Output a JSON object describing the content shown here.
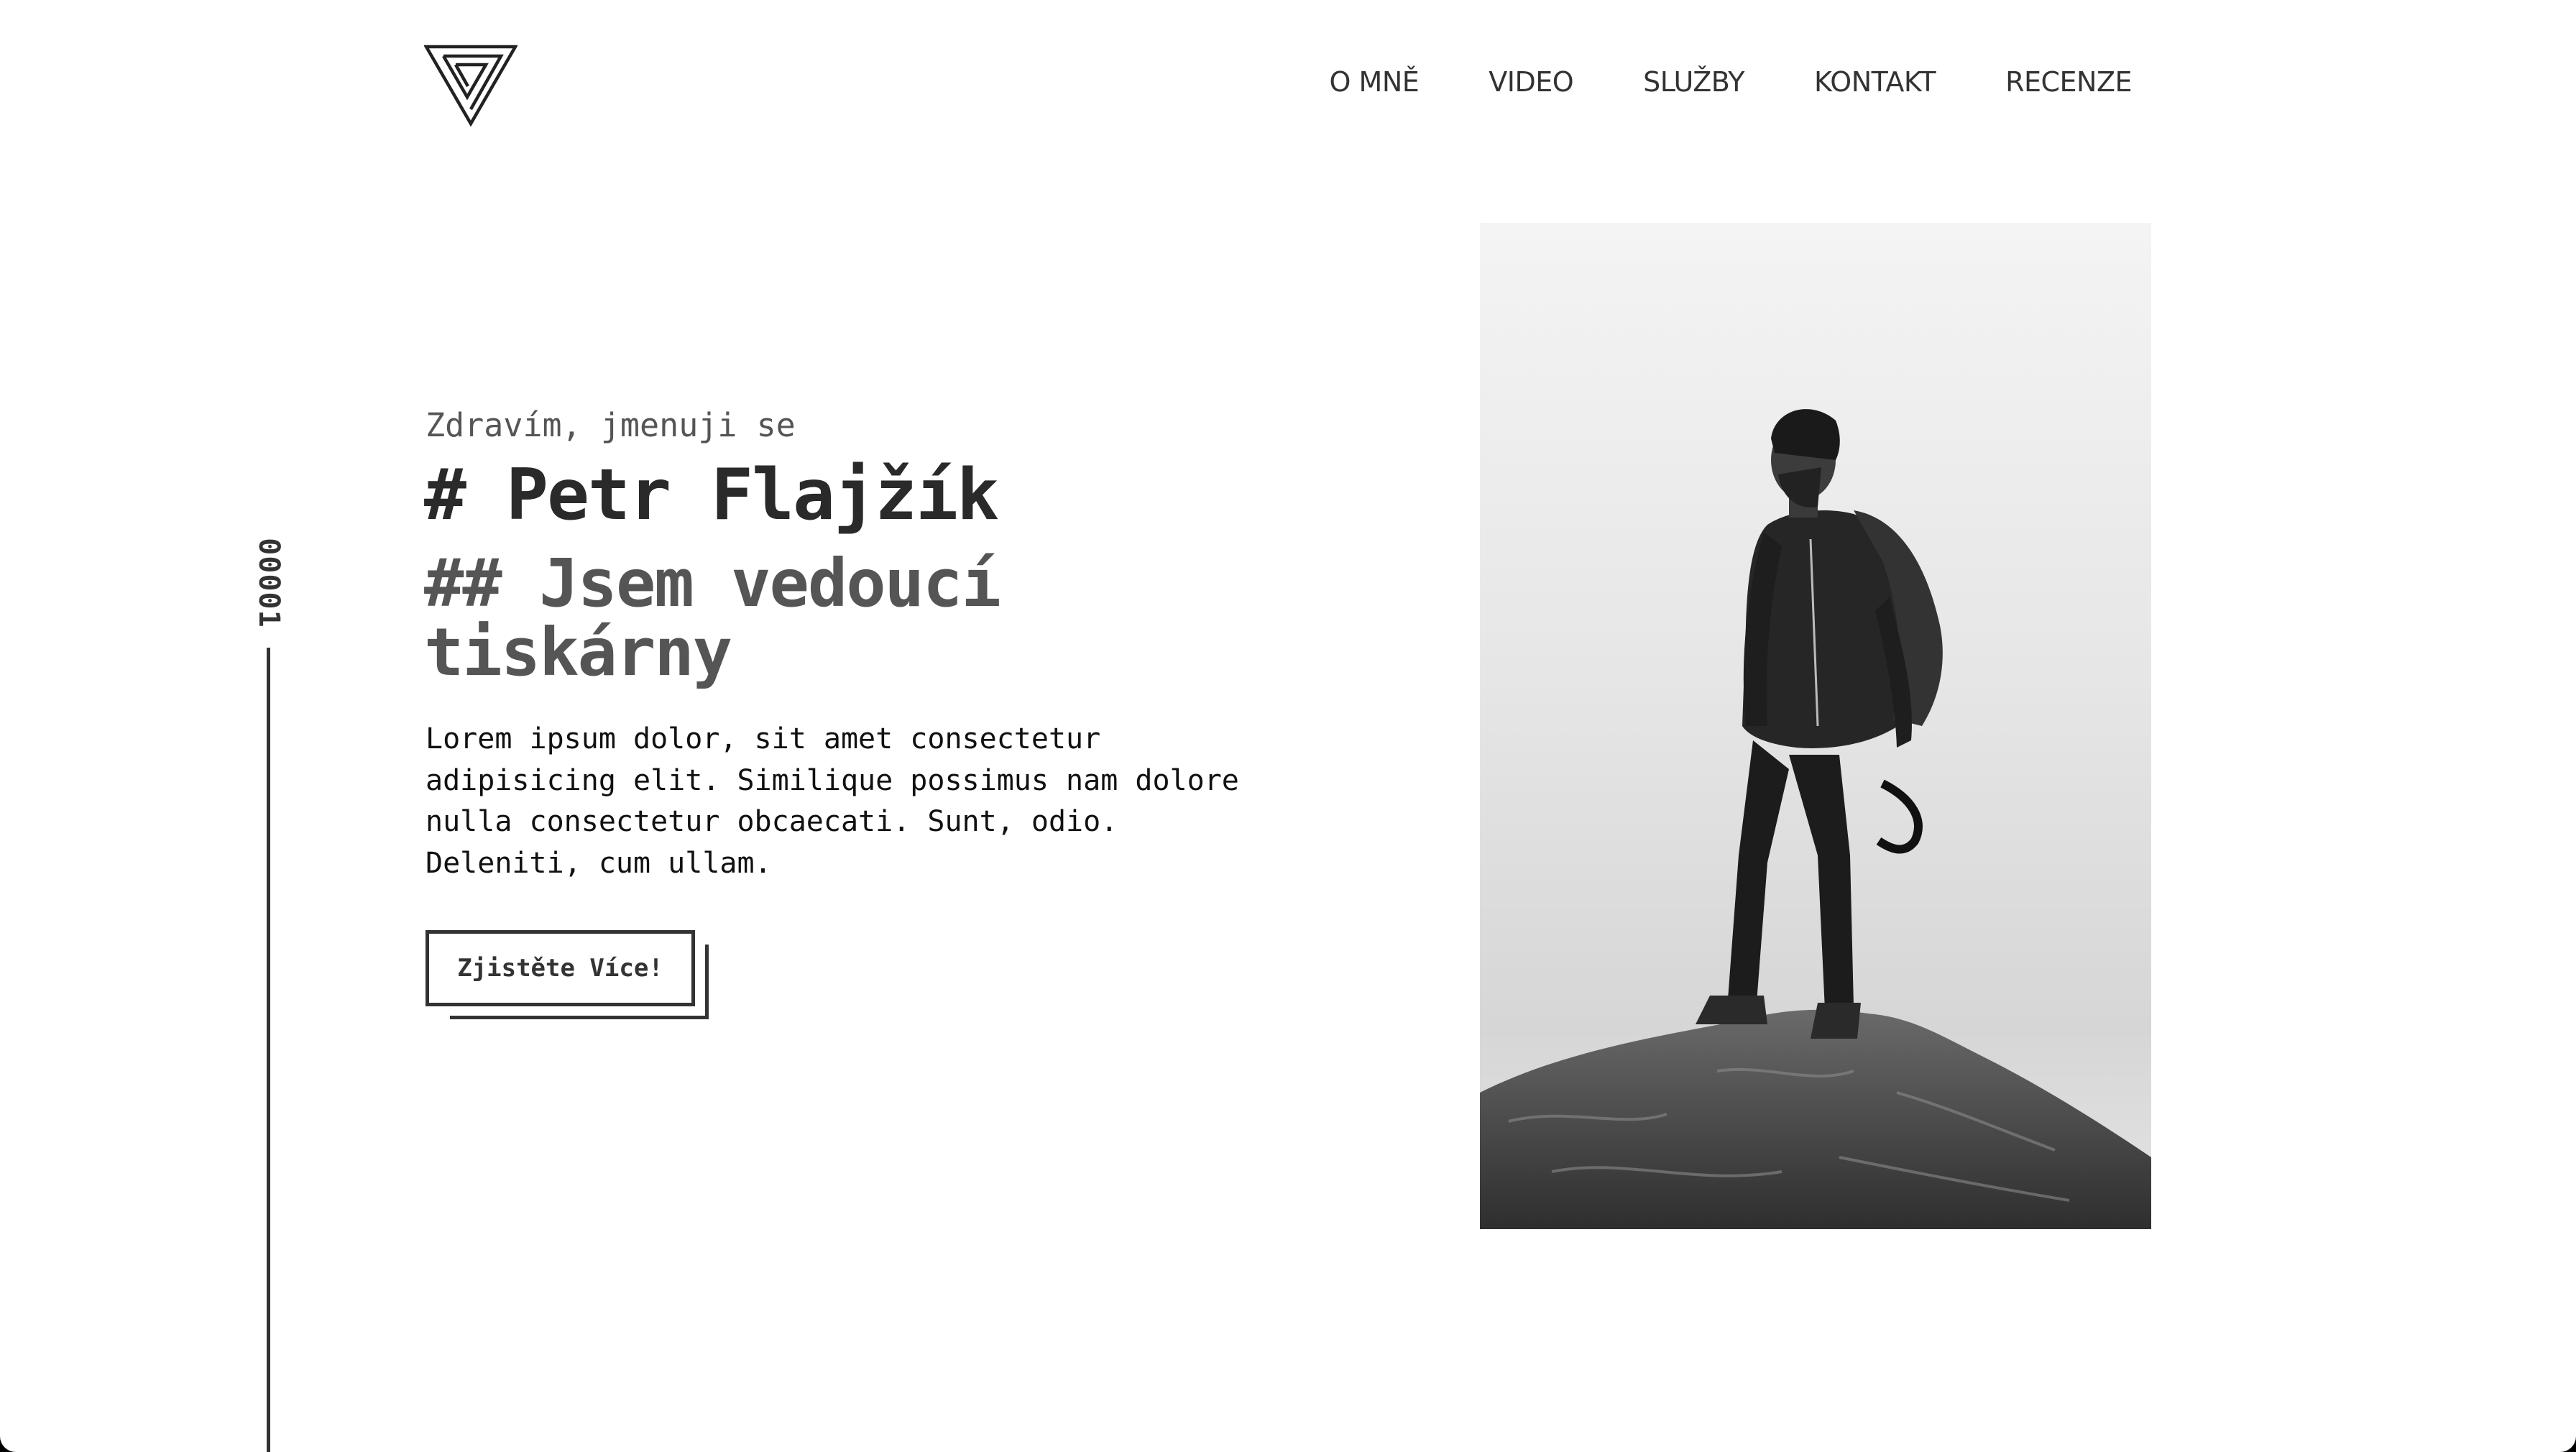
{
  "header": {
    "logo_icon": "impossible-triangle-logo",
    "nav": [
      {
        "label": "O MNĚ"
      },
      {
        "label": "VIDEO"
      },
      {
        "label": "SLUŽBY"
      },
      {
        "label": "KONTAKT"
      },
      {
        "label": "RECENZE"
      }
    ]
  },
  "side_indicator": {
    "counter": "00001"
  },
  "hero": {
    "greeting": "Zdravím, jmenuji se",
    "name": "# Petr Flajžík",
    "role": "## Jsem vedoucí tiskárny",
    "intro": "Lorem ipsum dolor, sit amet consectetur adipisicing elit. Similique possimus nam dolore nulla consectetur obcaecati. Sunt, odio. Deleniti, cum ullam.",
    "cta_label": "Zjistěte Více!",
    "photo_icon": "man-on-rock-photo"
  },
  "colors": {
    "text_dark": "#2a2a2a",
    "text_gray": "#555555",
    "background": "#ffffff"
  }
}
